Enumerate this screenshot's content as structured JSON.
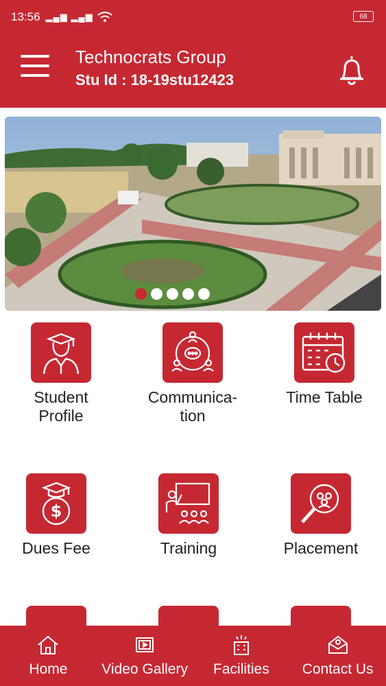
{
  "status_bar": {
    "time": "13:56",
    "signal_text": "▂▄▆ ▂▄▆",
    "battery": "68"
  },
  "header": {
    "title": "Technocrats Group",
    "subtitle": "Stu Id : 18-19stu12423"
  },
  "banner": {
    "slide_count": 5,
    "active_slide": 0
  },
  "tiles": [
    {
      "label": "Student\nProfile",
      "icon": "student-profile-icon"
    },
    {
      "label": "Communica-\ntion",
      "icon": "communication-icon"
    },
    {
      "label": "Time Table",
      "icon": "calendar-clock-icon"
    },
    {
      "label": "Dues Fee",
      "icon": "fee-graduation-icon"
    },
    {
      "label": "Training",
      "icon": "training-board-icon"
    },
    {
      "label": "Placement",
      "icon": "placement-search-icon"
    }
  ],
  "bottom_nav": [
    {
      "label": "Home",
      "icon": "home-icon"
    },
    {
      "label": "Video Gallery",
      "icon": "video-gallery-icon"
    },
    {
      "label": "Facilities",
      "icon": "facilities-icon"
    },
    {
      "label": "Contact Us",
      "icon": "contact-icon"
    }
  ],
  "colors": {
    "primary": "#c62832",
    "text": "#222222",
    "background": "#ffffff"
  }
}
